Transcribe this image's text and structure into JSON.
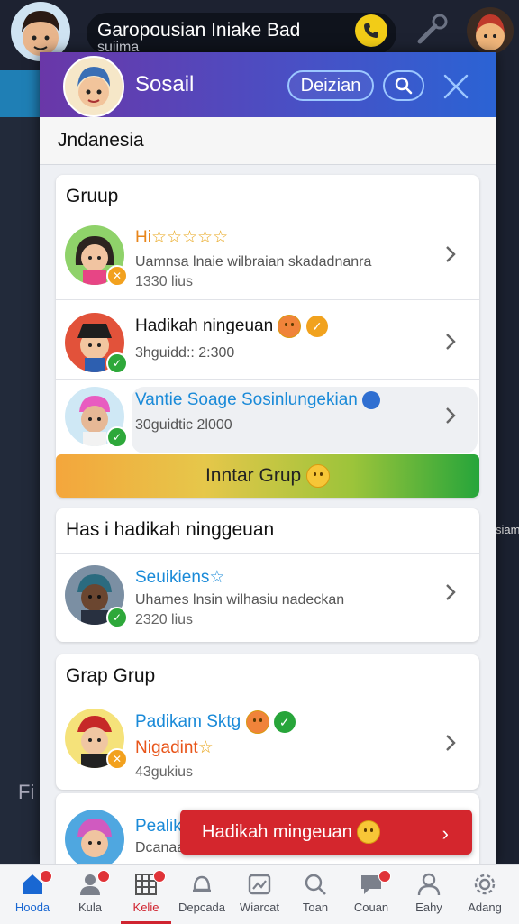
{
  "topbar": {
    "title": "Garopousian Iniake Bad",
    "subtitle": "suiima"
  },
  "modal": {
    "title": "Sosail",
    "action_button": "Deizian",
    "region": "Jndanesia"
  },
  "groups_card": {
    "title": "Gruup",
    "rows": [
      {
        "name": "Hi",
        "name_suffix": "☆☆☆☆☆",
        "desc": "Uamnsa lnaie wilbraian skadadnanra",
        "meta": "1330 lius"
      },
      {
        "name": "Hadikah ningeuan",
        "meta": "3hguidd:: 2:300"
      },
      {
        "name": "Vantie Soage Sosinlungekian",
        "meta": "30guidtic 2l000"
      }
    ],
    "cta": "Inntar Grup"
  },
  "gift_card": {
    "title": "Has i hadikah ninggeuan",
    "row": {
      "name": "Seuikiens",
      "name_suffix": "☆",
      "desc": "Uhames lnsin wilhasiu nadeckan",
      "meta": "2320 lius"
    }
  },
  "grap_card": {
    "title": "Grap Grup",
    "row": {
      "name": "Padikam Sktg",
      "line2": "Nigadint",
      "line2_suffix": "☆",
      "meta": "43gukius"
    },
    "row2": {
      "name": "Pealik",
      "desc": "Dcanaa"
    }
  },
  "toast": {
    "label": "Hadikah mingeuan"
  },
  "background": {
    "fi": "Fi",
    "side_text": "siam"
  },
  "bottom_nav": {
    "items": [
      {
        "label": "Hooda",
        "icon": "home-icon"
      },
      {
        "label": "Kula",
        "icon": "profile-icon"
      },
      {
        "label": "Kelie",
        "icon": "grid-icon"
      },
      {
        "label": "Depcada",
        "icon": "bell-icon"
      },
      {
        "label": "Wiarcat",
        "icon": "image-icon"
      },
      {
        "label": "Toan",
        "icon": "search-icon"
      },
      {
        "label": "Couan",
        "icon": "chat-icon"
      },
      {
        "label": "Eahy",
        "icon": "user-icon"
      },
      {
        "label": "Adang",
        "icon": "gear-icon"
      }
    ]
  },
  "colors": {
    "header_start": "#6a37a8",
    "header_end": "#2b63d4",
    "accent_orange": "#e8851a",
    "accent_blue": "#1a8ad8",
    "toast": "#d4262d",
    "nav_active": "#1967d2"
  }
}
